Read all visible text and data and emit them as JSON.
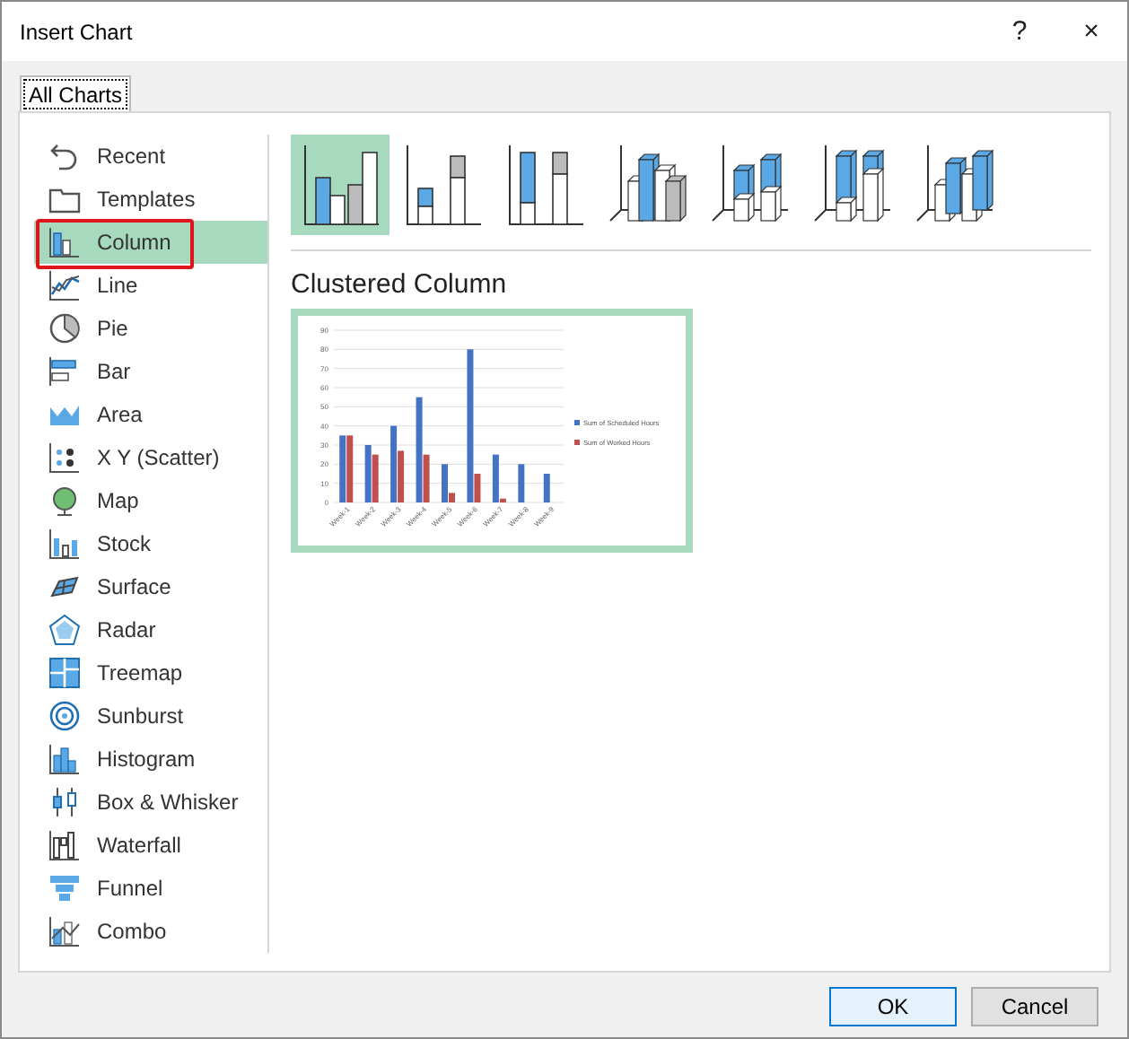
{
  "window": {
    "title": "Insert Chart",
    "help": "?",
    "close": "×"
  },
  "tabs": [
    {
      "label": "All Charts",
      "selected": true
    }
  ],
  "sidebar": {
    "items": [
      {
        "label": "Recent",
        "kind": "recent",
        "selected": false
      },
      {
        "label": "Templates",
        "kind": "templates",
        "selected": false
      },
      {
        "label": "Column",
        "kind": "column",
        "selected": true
      },
      {
        "label": "Line",
        "kind": "line",
        "selected": false
      },
      {
        "label": "Pie",
        "kind": "pie",
        "selected": false
      },
      {
        "label": "Bar",
        "kind": "bar",
        "selected": false
      },
      {
        "label": "Area",
        "kind": "area",
        "selected": false
      },
      {
        "label": "X Y (Scatter)",
        "kind": "scatter",
        "selected": false
      },
      {
        "label": "Map",
        "kind": "map",
        "selected": false
      },
      {
        "label": "Stock",
        "kind": "stock",
        "selected": false
      },
      {
        "label": "Surface",
        "kind": "surface",
        "selected": false
      },
      {
        "label": "Radar",
        "kind": "radar",
        "selected": false
      },
      {
        "label": "Treemap",
        "kind": "treemap",
        "selected": false
      },
      {
        "label": "Sunburst",
        "kind": "sunburst",
        "selected": false
      },
      {
        "label": "Histogram",
        "kind": "histogram",
        "selected": false
      },
      {
        "label": "Box & Whisker",
        "kind": "box",
        "selected": false
      },
      {
        "label": "Waterfall",
        "kind": "waterfall",
        "selected": false
      },
      {
        "label": "Funnel",
        "kind": "funnel",
        "selected": false
      },
      {
        "label": "Combo",
        "kind": "combo",
        "selected": false
      }
    ]
  },
  "chart_types": [
    {
      "kind": "clustered",
      "selected": true
    },
    {
      "kind": "stacked",
      "selected": false
    },
    {
      "kind": "stacked100",
      "selected": false
    },
    {
      "kind": "clustered3d",
      "selected": false
    },
    {
      "kind": "stacked3d",
      "selected": false
    },
    {
      "kind": "stacked100_3d",
      "selected": false
    },
    {
      "kind": "column3d",
      "selected": false
    }
  ],
  "preview": {
    "title": "Clustered Column",
    "chart_data": {
      "type": "bar",
      "categories": [
        "Week-1",
        "Week-2",
        "Week-3",
        "Week-4",
        "Week-5",
        "Week-6",
        "Week-7",
        "Week-8",
        "Week-9"
      ],
      "series": [
        {
          "name": "Sum of Scheduled Hours",
          "color": "#4472c4",
          "values": [
            35,
            30,
            40,
            55,
            20,
            80,
            25,
            20,
            15
          ]
        },
        {
          "name": "Sum of Worked Hours",
          "color": "#c0504d",
          "values": [
            35,
            25,
            27,
            25,
            5,
            15,
            2,
            null,
            null
          ]
        }
      ],
      "grid": true,
      "legend": true,
      "ylim": [
        0,
        90
      ],
      "yticks": [
        0,
        10,
        20,
        30,
        40,
        50,
        60,
        70,
        80,
        90
      ]
    }
  },
  "buttons": [
    {
      "label": "OK",
      "kind": "default"
    },
    {
      "label": "Cancel",
      "kind": "normal"
    }
  ]
}
